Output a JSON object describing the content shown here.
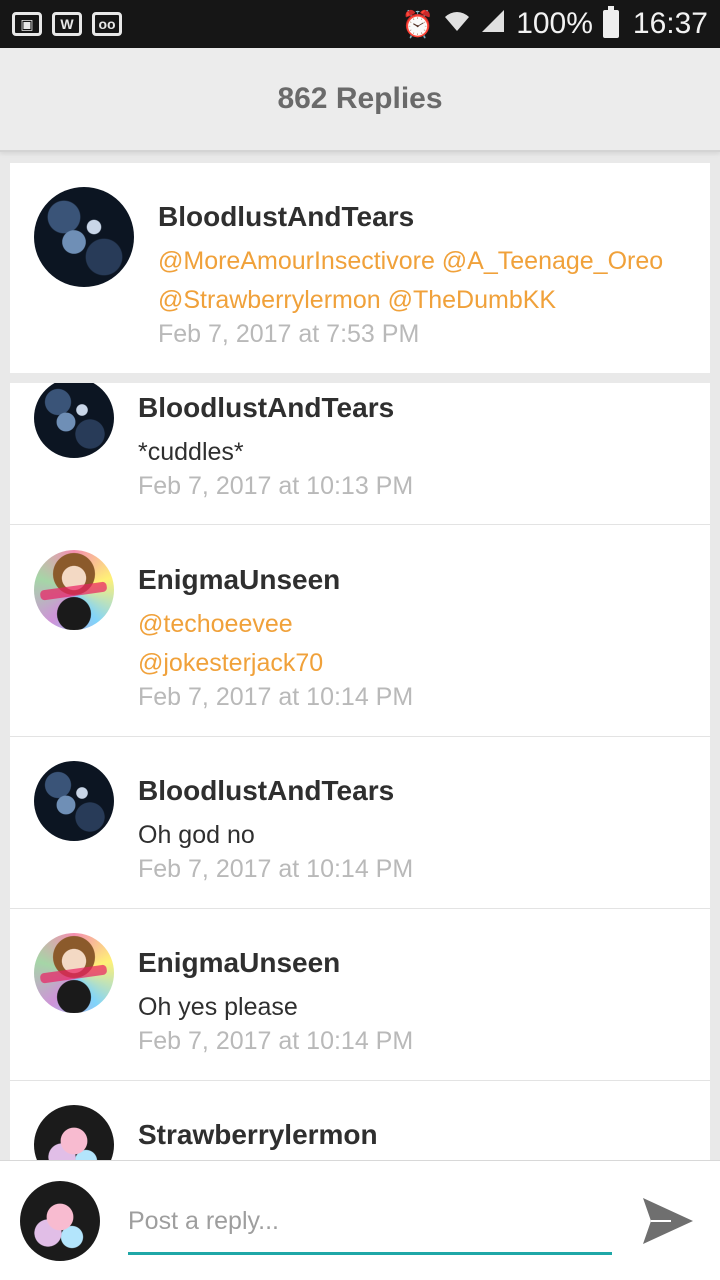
{
  "status_bar": {
    "battery": "100%",
    "time": "16:37",
    "icons": [
      "gallery-icon",
      "w-app-icon",
      "voicemail-icon",
      "alarm-icon",
      "wifi-icon",
      "signal-icon",
      "battery-icon"
    ]
  },
  "header": {
    "title": "862 Replies"
  },
  "original_post": {
    "username": "BloodlustAndTears",
    "mention_line1": "@MoreAmourInsectivore @A_Teenage_Oreo",
    "mention_line2": "@Strawberrylermon @TheDumbKK",
    "timestamp": "Feb 7, 2017 at 7:53 PM"
  },
  "replies": [
    {
      "username": "BloodlustAndTears",
      "text": "*cuddles*",
      "timestamp": "Feb 7, 2017 at 10:13 PM"
    },
    {
      "username": "EnigmaUnseen",
      "mention1": "@techoeevee",
      "mention2": "@jokesterjack70",
      "timestamp": "Feb 7, 2017 at 10:14 PM"
    },
    {
      "username": "BloodlustAndTears",
      "text": "Oh god no",
      "timestamp": "Feb 7, 2017 at 10:14 PM"
    },
    {
      "username": "EnigmaUnseen",
      "text": "Oh yes please",
      "timestamp": "Feb 7, 2017 at 10:14 PM"
    },
    {
      "username": "Strawberrylermon"
    }
  ],
  "composer": {
    "placeholder": "Post a reply..."
  },
  "colors": {
    "mention": "#f0a13a",
    "accent_underline": "#1fa7a7",
    "timestamp": "#b9b9b9"
  }
}
